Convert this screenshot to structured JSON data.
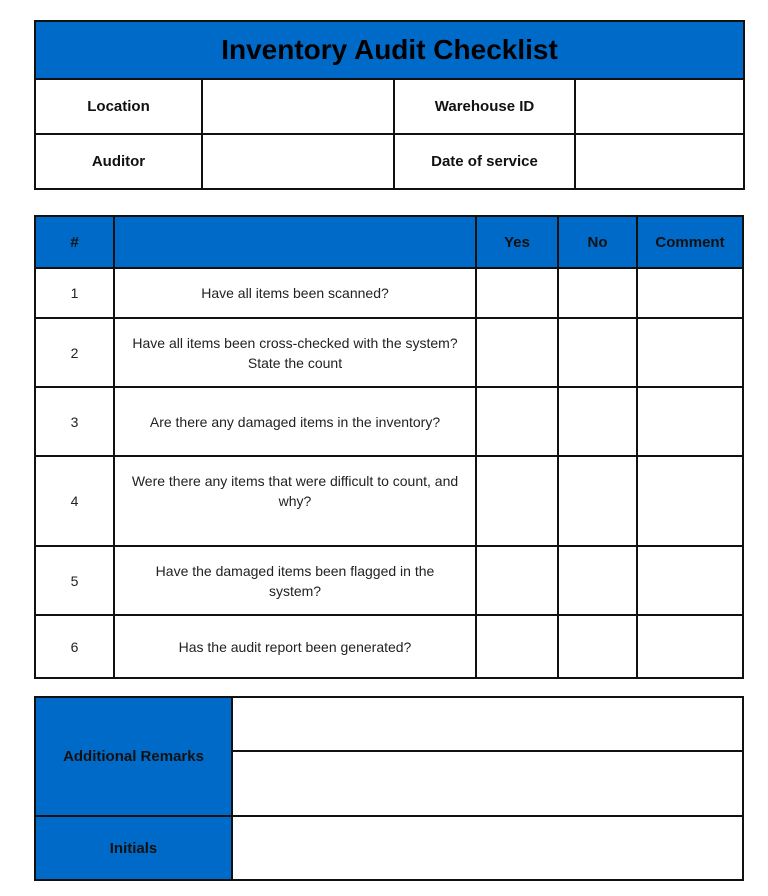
{
  "title": "Inventory Audit Checklist",
  "colors": {
    "accent": "#006AC8",
    "border": "#111111"
  },
  "info": {
    "location_label": "Location",
    "location_value": "",
    "warehouse_id_label": "Warehouse ID",
    "warehouse_id_value": "",
    "auditor_label": "Auditor",
    "auditor_value": "",
    "date_label": "Date of service",
    "date_value": ""
  },
  "checklist": {
    "headers": {
      "number": "#",
      "question": "",
      "yes": "Yes",
      "no": "No",
      "comment": "Comment"
    },
    "rows": [
      {
        "number": "1",
        "question": "Have all items been scanned?",
        "yes": "",
        "no": "",
        "comment": ""
      },
      {
        "number": "2",
        "question": "Have all items been cross-checked with the system? State the count",
        "yes": "",
        "no": "",
        "comment": ""
      },
      {
        "number": "3",
        "question": "Are there any damaged items in the inventory?",
        "yes": "",
        "no": "",
        "comment": ""
      },
      {
        "number": "4",
        "question": "Were there any items that were difficult to count, and why?",
        "yes": "",
        "no": "",
        "comment": ""
      },
      {
        "number": "5",
        "question": "Have the damaged items been flagged in the system?",
        "yes": "",
        "no": "",
        "comment": ""
      },
      {
        "number": "6",
        "question": "Has the audit report been generated?",
        "yes": "",
        "no": "",
        "comment": ""
      }
    ]
  },
  "footer": {
    "remarks_label": "Additional Remarks",
    "remarks_line_1": "",
    "remarks_line_2": "",
    "initials_label": "Initials",
    "initials_value": ""
  }
}
